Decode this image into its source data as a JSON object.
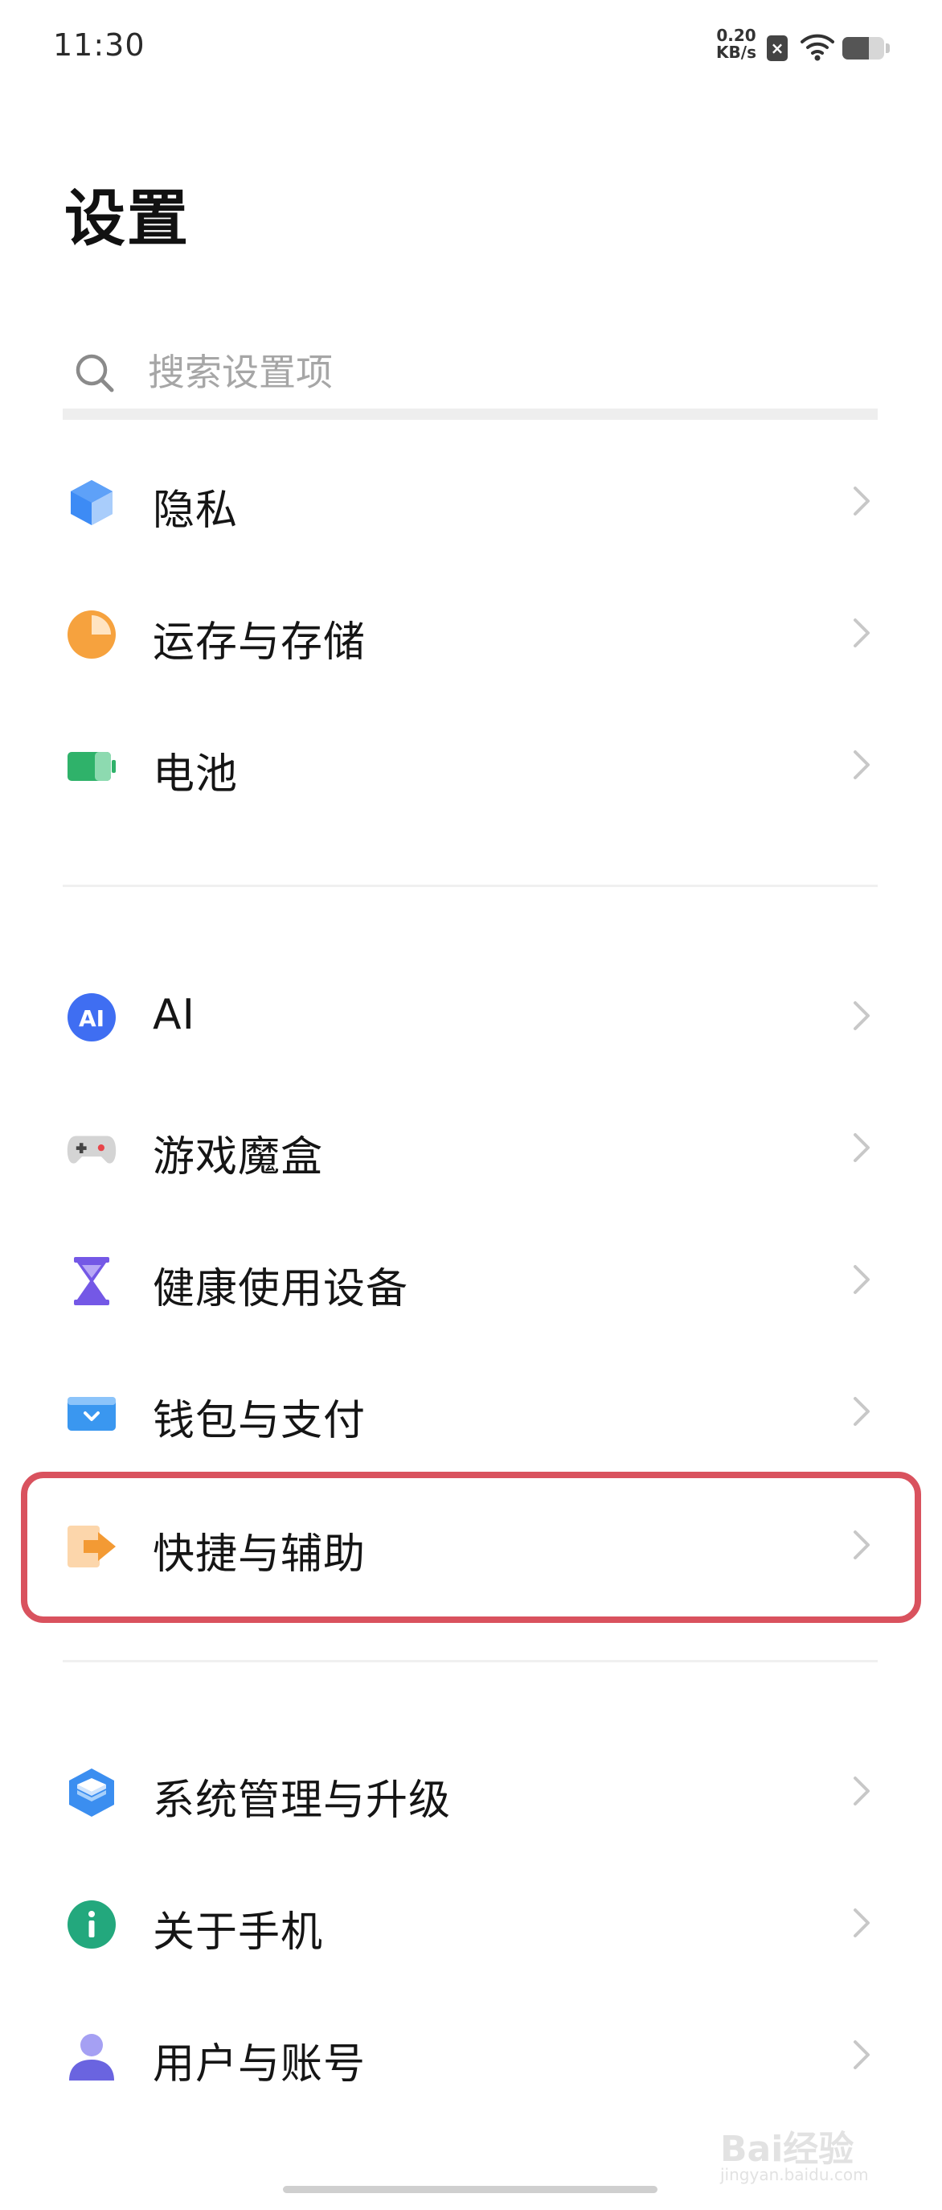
{
  "status_bar": {
    "time": "11:30",
    "net_speed_value": "0.20",
    "net_speed_unit": "KB/s",
    "sim_indicator": "×",
    "icons": [
      "sim-off-icon",
      "wifi-icon",
      "battery-icon"
    ]
  },
  "page": {
    "title": "设置"
  },
  "search": {
    "placeholder": "搜索设置项",
    "value": ""
  },
  "groups": [
    {
      "items": [
        {
          "label": "隐私",
          "icon": "privacy-cube-icon",
          "color": "#3d8bf5"
        },
        {
          "label": "运存与存储",
          "icon": "storage-pie-icon",
          "color": "#f6a23e"
        },
        {
          "label": "电池",
          "icon": "battery-icon",
          "color": "#2fb26a"
        }
      ]
    },
    {
      "items": [
        {
          "label": "AI",
          "icon": "ai-badge-icon",
          "color": "#3f6ef2"
        },
        {
          "label": "游戏魔盒",
          "icon": "gamepad-icon",
          "color": "#c9c9c9"
        },
        {
          "label": "健康使用设备",
          "icon": "hourglass-icon",
          "color": "#7458e6"
        },
        {
          "label": "钱包与支付",
          "icon": "wallet-icon",
          "color": "#3a97f0"
        },
        {
          "label": "快捷与辅助",
          "icon": "shortcut-arrow-icon",
          "color": "#f39a34",
          "highlighted": true
        }
      ]
    },
    {
      "items": [
        {
          "label": "系统管理与升级",
          "icon": "layers-icon",
          "color": "#3b8ef0"
        },
        {
          "label": "关于手机",
          "icon": "info-icon",
          "color": "#23a87d"
        },
        {
          "label": "用户与账号",
          "icon": "user-icon",
          "color": "#6a64e0"
        }
      ]
    }
  ],
  "highlight_color": "#d9525e",
  "watermark": {
    "text": "Bai经验",
    "url": "jingyan.baidu.com"
  }
}
